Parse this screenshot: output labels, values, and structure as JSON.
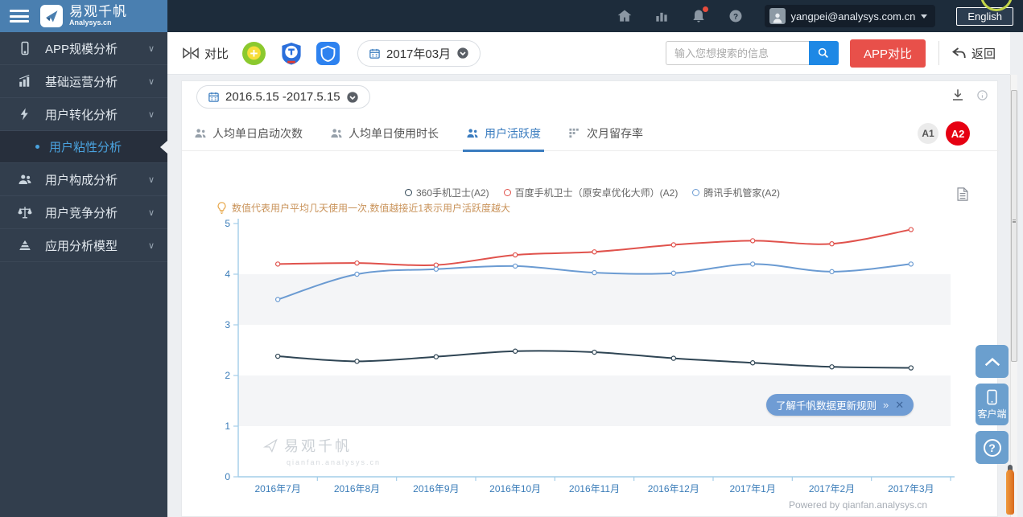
{
  "topbar": {
    "brand": {
      "title": "易观千帆",
      "subtitle": "Analysys.cn"
    },
    "user_email": "yangpei@analysys.com.cn",
    "language_button": "English"
  },
  "sidebar": {
    "items": [
      {
        "label": "APP规模分析"
      },
      {
        "label": "基础运营分析"
      },
      {
        "label": "用户转化分析"
      },
      {
        "label": "用户构成分析"
      },
      {
        "label": "用户竞争分析"
      },
      {
        "label": "应用分析模型"
      }
    ],
    "active_subitem": "用户粘性分析",
    "chevron_glyph": "∨"
  },
  "toolbar": {
    "compare_label": "对比",
    "month_selector": "2017年03月",
    "search_placeholder": "输入您想搜索的信息",
    "app_compare_button": "APP对比",
    "back_button": "返回"
  },
  "panel": {
    "date_range": "2016.5.15 -2017.5.15",
    "tabs": [
      {
        "label": "人均单日启动次数",
        "active": false
      },
      {
        "label": "人均单日使用时长",
        "active": false
      },
      {
        "label": "用户活跃度",
        "active": true
      },
      {
        "label": "次月留存率",
        "active": false
      }
    ],
    "badges": [
      "A1",
      "A2"
    ],
    "note": "数值代表用户平均几天使用一次,数值越接近1表示用户活跃度越大",
    "tooltip": {
      "text": "了解千帆数据更新规则",
      "more": "»",
      "close": "✕"
    },
    "watermark": {
      "title": "易观千帆",
      "subtitle": "qianfan.analysys.cn"
    },
    "powered_by": "Powered by qianfan.analysys.cn"
  },
  "floating": {
    "client_label": "客户端",
    "help_glyph": "?"
  },
  "colors": {
    "topbar_bg": "#1d2c3b",
    "logo_bg": "#4a7fb0",
    "sidebar_bg": "#323e4d",
    "sidebar_active_text": "#4aa3df",
    "tab_active": "#3a7cbf",
    "app_compare_red": "#e8504a",
    "search_blue": "#1e88e5",
    "badge_a2_red": "#e60012",
    "note_text": "#c9935a",
    "axis_label_blue": "#3a7cb8",
    "axis_line_blue": "#a3cde8",
    "band_gray": "#f4f5f7"
  },
  "chart_data": {
    "type": "line",
    "categories": [
      "2016年7月",
      "2016年8月",
      "2016年9月",
      "2016年10月",
      "2016年11月",
      "2016年12月",
      "2017年1月",
      "2017年2月",
      "2017年3月"
    ],
    "series": [
      {
        "name": "360手机卫士(A2)",
        "color": "#2f4554",
        "values": [
          2.38,
          2.28,
          2.37,
          2.48,
          2.46,
          2.34,
          2.25,
          2.17,
          2.15
        ]
      },
      {
        "name": "百度手机卫士（原安卓优化大师）(A2)",
        "color": "#e0524c",
        "values": [
          4.2,
          4.22,
          4.18,
          4.38,
          4.44,
          4.58,
          4.66,
          4.6,
          4.88
        ]
      },
      {
        "name": "腾讯手机管家(A2)",
        "color": "#6b9bd2",
        "values": [
          3.5,
          4.0,
          4.1,
          4.16,
          4.03,
          4.02,
          4.2,
          4.05,
          4.2
        ]
      }
    ],
    "ylim": [
      0,
      5
    ],
    "yticks": [
      0,
      1,
      2,
      3,
      4,
      5
    ],
    "grid": "alternating horizontal bands (3-4 and 1-2 shaded)",
    "legend_position": "top-center",
    "xlabel": "",
    "ylabel": ""
  }
}
